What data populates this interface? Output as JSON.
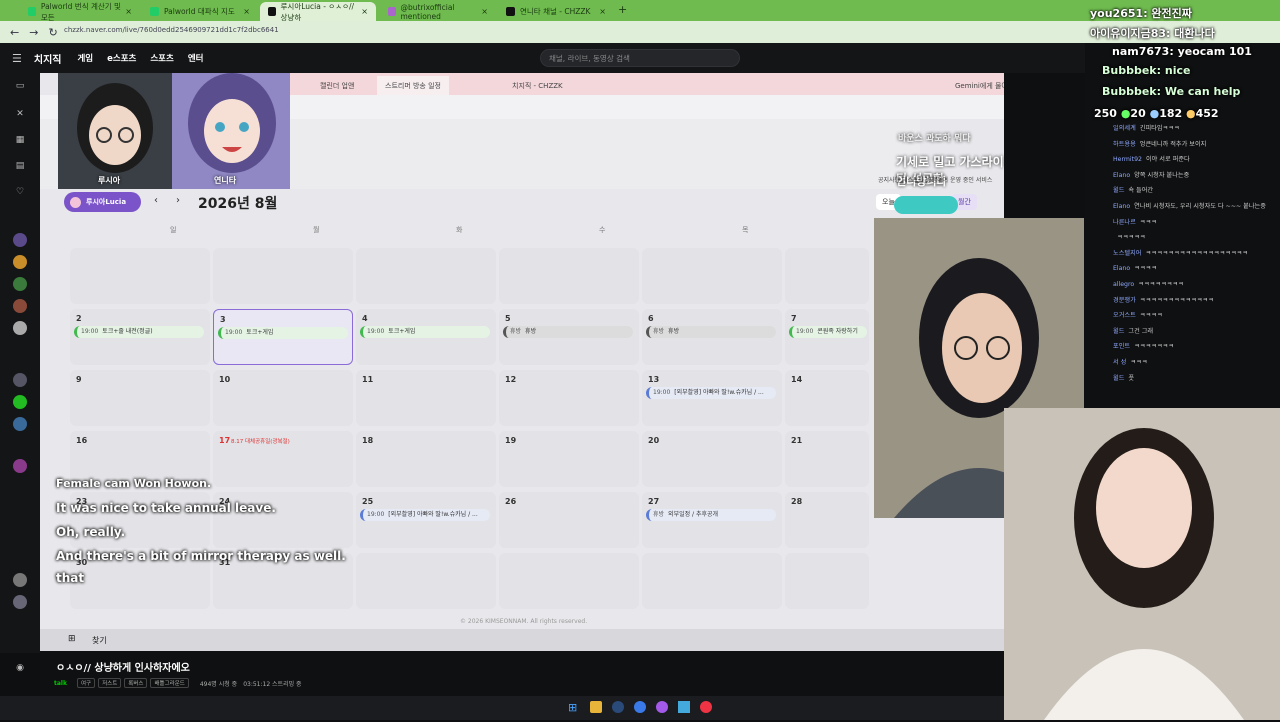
{
  "tabs": [
    {
      "label": "Palworld 번식 계산기 및 모든"
    },
    {
      "label": "Palworld 대파식 지도"
    },
    {
      "label": "루시아Lucia - ㅇㅅㅇ// 상냥하"
    },
    {
      "label": "@butrixofficial mentioned"
    },
    {
      "label": "연니타 채널 - CHZZK"
    }
  ],
  "url": "chzzk.naver.com/live/760d0edd2546909721dd1c7f2dbc6641",
  "site": {
    "logo": "치지직",
    "menu": [
      "게임",
      "e스포츠",
      "스포츠",
      "엔터"
    ],
    "search_placeholder": "채널, 라이브, 동영상 검색"
  },
  "inner_browser": {
    "tabs": [
      "캘린더 업앤",
      "스트리머 방송 일정",
      "치지직 - CHZZK"
    ],
    "gemini": "Gemini에게 물어보기"
  },
  "characters": {
    "left": "루시아",
    "right": "연니타"
  },
  "calendar": {
    "streamer": "루시아Lucia",
    "month_title": "2026년 8월",
    "prev": "‹",
    "next": "›",
    "weekdays": [
      "일",
      "월",
      "화",
      "수",
      "목",
      "금"
    ],
    "view_today": "오늘",
    "view_week": "주간",
    "view_month": "월간",
    "rows": [
      [
        {
          "d": ""
        },
        {
          "d": ""
        },
        {
          "d": ""
        },
        {
          "d": ""
        },
        {
          "d": ""
        },
        {
          "d": ""
        }
      ],
      [
        {
          "d": "2",
          "e": "토크+줄 내전(정글)",
          "t": "19:00",
          "k": "green"
        },
        {
          "d": "3",
          "e": "토크+게임",
          "t": "19:00",
          "k": "green",
          "sel": true
        },
        {
          "d": "4",
          "e": "토크+게임",
          "t": "19:00",
          "k": "green"
        },
        {
          "d": "5",
          "e": "휴방",
          "t": "휴방",
          "k": "gray"
        },
        {
          "d": "6",
          "e": "휴방",
          "t": "휴방",
          "k": "gray"
        },
        {
          "d": "7",
          "e": "콘원족 자랑하기",
          "t": "19:00",
          "k": "green"
        }
      ],
      [
        {
          "d": "9"
        },
        {
          "d": "10"
        },
        {
          "d": "11"
        },
        {
          "d": "12"
        },
        {
          "d": "13",
          "e": "[외부촬영] 아빠와 딸!w.슈카님 / ...",
          "t": "19:00",
          "k": "blue"
        },
        {
          "d": "14"
        }
      ],
      [
        {
          "d": "16"
        },
        {
          "d": "17",
          "note": "8.17 대체공휴일(광복절)",
          "red": true
        },
        {
          "d": "18"
        },
        {
          "d": "19"
        },
        {
          "d": "20"
        },
        {
          "d": "21"
        }
      ],
      [
        {
          "d": "23"
        },
        {
          "d": "24"
        },
        {
          "d": "25",
          "e": "[외부촬영] 아빠와 딸!w.슈카님 / ...",
          "t": "19:00",
          "k": "blue"
        },
        {
          "d": "26"
        },
        {
          "d": "27",
          "e": "외부일정 / 추후공개",
          "t": "휴방",
          "k": "blue"
        },
        {
          "d": "28"
        }
      ],
      [
        {
          "d": "30"
        },
        {
          "d": "31"
        },
        {
          "d": ""
        },
        {
          "d": ""
        },
        {
          "d": ""
        },
        {
          "d": ""
        }
      ]
    ],
    "copyright": "© 2026 KIMSEONNAM. All rights reserved."
  },
  "overlay": {
    "line1": "바운스 과도하 뭐다",
    "line2": "기세로 밀고 가스라이팅 성공한",
    "line3": "언니방니다",
    "sub3": "공지사항 테스트를 병행하며 운영 중인 서비스"
  },
  "subtitles": [
    "Female cam Won Howon.",
    "It was nice to take annual leave.",
    "Oh, really.",
    "And there's a bit of mirror therapy as well.",
    "that"
  ],
  "chat_overlay": [
    {
      "name": "you2651",
      "text": "완전진짜"
    },
    {
      "name": "아이유이지금83",
      "text": "대환나다"
    },
    {
      "name": "nam7673",
      "text": "yeocam 101"
    },
    {
      "name": "Bubbbek",
      "text": "nice"
    },
    {
      "name": "Bubbbek",
      "text": "We can help"
    }
  ],
  "stats": {
    "a": "250",
    "b": "20",
    "c": "182",
    "d": "452"
  },
  "chat": [
    {
      "name": "일의세계",
      "text": "긴피타임ㅋㅋㅋ"
    },
    {
      "name": "하트용용",
      "text": "엉큰네니까 적추가 보이지"
    },
    {
      "name": "Hermit92",
      "text": "이야 서로 퍼준다"
    },
    {
      "name": "Elano",
      "text": "양쪽 시청자 붙나는중"
    },
    {
      "name": "윌드",
      "text": "쇽 들어간"
    },
    {
      "name": "Elano",
      "text": "연나비 시청자도, 우리 시청자도 다 ~~~ 붙나는중"
    },
    {
      "name": "나른나르",
      "text": "ㅋㅋㅋ"
    },
    {
      "name": "",
      "text": "ㅋㅋㅋㅋㅋ"
    },
    {
      "name": "노스텔지어",
      "text": "ㅋㅋㅋㅋㅋㅋㅋㅋㅋㅋㅋㅋㅋㅋㅋㅋㅋㅋ"
    },
    {
      "name": "Elano",
      "text": "ㅋㅋㅋㅋ"
    },
    {
      "name": "allegro",
      "text": "ㅋㅋㅋㅋㅋㅋㅋㅋ"
    },
    {
      "name": "경분쟁가",
      "text": "ㅋㅋㅋㅋㅋㅋㅋㅋㅋㅋㅋㅋㅋ"
    },
    {
      "name": "오거스트",
      "text": "ㅋㅋㅋㅋ"
    },
    {
      "name": "윌드",
      "text": "그건 그래"
    },
    {
      "name": "포인트",
      "text": "ㅋㅋㅋㅋㅋㅋㅋ"
    },
    {
      "name": "서 성",
      "text": "ㅋㅋㅋ"
    },
    {
      "name": "윌드",
      "text": "풋"
    }
  ],
  "stream_info": {
    "title": "ㅇㅅㅇ// 상냥하게 인사하자에오",
    "badge": "talk",
    "tags": [
      "여구",
      "저스트",
      "록버스",
      "배틀그라운드"
    ],
    "viewers": "494명 시청 중",
    "duration": "03:51:12 스트리밍 중"
  },
  "taskbar_search": "찾기"
}
